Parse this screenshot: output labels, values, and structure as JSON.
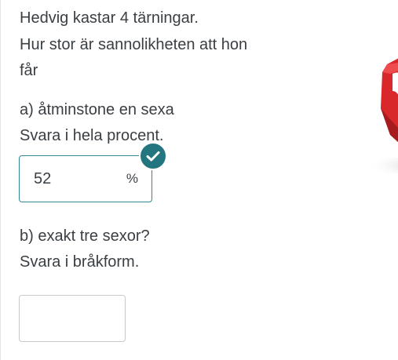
{
  "question": {
    "intro_line1": "Hedvig kastar 4 tärningar.",
    "intro_line2": "Hur stor är sannolikheten att hon",
    "intro_line3": "får"
  },
  "part_a": {
    "prompt": "a) åtminstone en sexa",
    "instruction": "Svara i hela procent.",
    "answer_value": "52",
    "unit": "%",
    "status": "correct"
  },
  "part_b": {
    "prompt": "b) exakt tre sexor?",
    "instruction": "Svara i bråkform.",
    "answer_value": ""
  },
  "icons": {
    "check": "check-icon",
    "dice": "dice-image"
  },
  "colors": {
    "accent": "#23757f",
    "input_border_correct": "#2f8a92",
    "input_border_default": "#c9c9c9",
    "dice_red": "#d8282c"
  }
}
